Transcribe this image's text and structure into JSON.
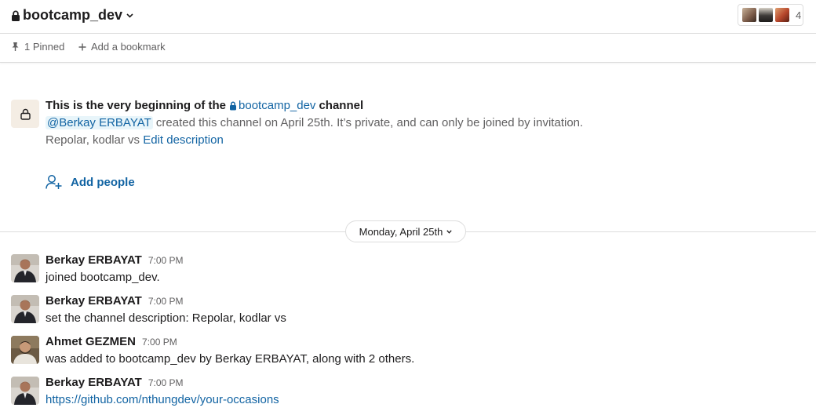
{
  "header": {
    "channel_name": "bootcamp_dev",
    "member_count": "4",
    "member_avatar_colors": [
      "#7a5a48",
      "#3d3a38",
      "#b5452a"
    ]
  },
  "bookmarks": {
    "pinned_label": "1 Pinned",
    "add_bookmark_label": "Add a bookmark"
  },
  "intro": {
    "title_prefix": "This is the very beginning of the",
    "channel_name": "bootcamp_dev",
    "title_suffix": "channel",
    "creator_mention": "@Berkay ERBAYAT",
    "created_text": " created this channel on April 25th. It’s private, and can only be joined by invitation.",
    "description_text": "Repolar, kodlar vs ",
    "edit_description_label": "Edit description",
    "add_people_label": "Add people"
  },
  "date_divider": {
    "label": "Monday, April 25th"
  },
  "messages": [
    {
      "author": "Berkay ERBAYAT",
      "time": "7:00 PM",
      "text": "joined bootcamp_dev.",
      "avatar": "person-photo"
    },
    {
      "author": "Berkay ERBAYAT",
      "time": "7:00 PM",
      "text": "set the channel description: Repolar, kodlar vs",
      "avatar": "person-photo"
    },
    {
      "author": "Ahmet GEZMEN",
      "time": "7:00 PM",
      "text": "was added to bootcamp_dev by Berkay ERBAYAT, along with 2 others.",
      "avatar": "person-photo"
    },
    {
      "author": "Berkay ERBAYAT",
      "time": "7:00 PM",
      "text": "https://github.com/nthungdev/your-occasions",
      "avatar": "person-photo"
    }
  ],
  "colors": {
    "link": "#1264a3",
    "muted": "#616061",
    "text": "#1d1c1d",
    "border": "#dddddd",
    "mention_bg": "#e8f5fa",
    "intro_icon_bg": "#f4ede4"
  }
}
